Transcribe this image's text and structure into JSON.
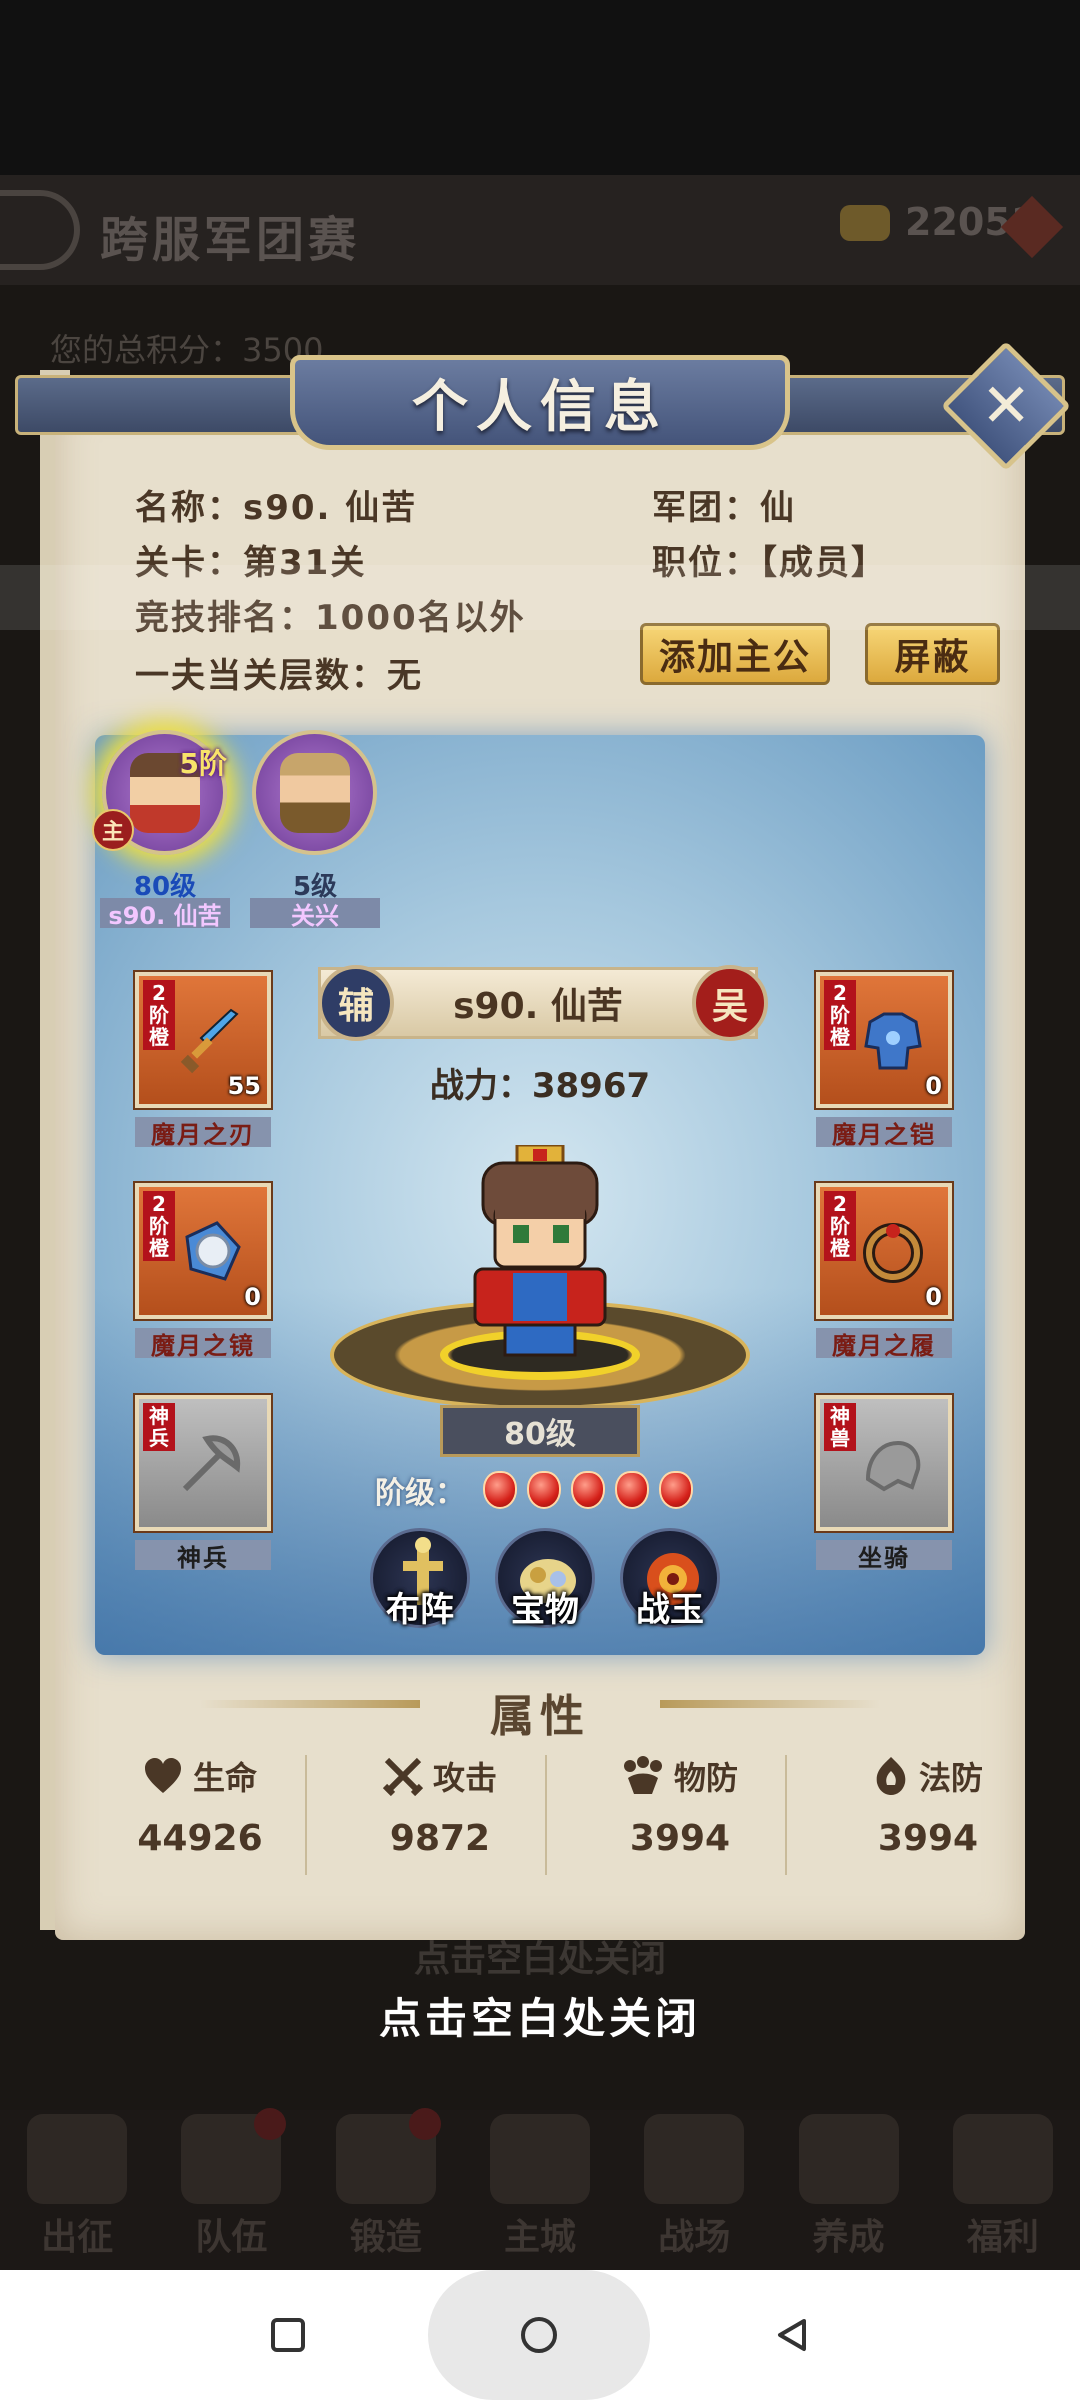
{
  "background": {
    "title": "跨服军团赛",
    "gold": "22051",
    "score_label": "您的总积分：3500",
    "close_hint_echo": "点击空白处关闭",
    "nav": [
      {
        "label": "出征"
      },
      {
        "label": "队伍"
      },
      {
        "label": "锻造"
      },
      {
        "label": "主城"
      },
      {
        "label": "战场"
      },
      {
        "label": "养成"
      },
      {
        "label": "福利"
      }
    ]
  },
  "dialog": {
    "title": "个人信息",
    "name": "名称：s90. 仙苦",
    "guild": "军团：仙",
    "stage": "关卡：第31关",
    "position": "职位：【成员】",
    "arena_rank": "竞技排名：1000名以外",
    "tower_floor": "一夫当关层数：无",
    "add_lord_button": "添加主公",
    "block_button": "屏蔽"
  },
  "heroes": [
    {
      "level": "80级",
      "name": "s90. 仙苦",
      "stage_badge": "5阶",
      "lord_badge": "主"
    },
    {
      "level": "5级",
      "name": "关兴"
    }
  ],
  "detail": {
    "role_left": "辅",
    "hero_name": "s90. 仙苦",
    "faction": "吴",
    "power": "战力：38967",
    "level": "80级",
    "stage_label": "阶级：",
    "stage_gems": 5
  },
  "equipment": [
    {
      "name": "魔月之刃",
      "tag": "2阶橙",
      "count": "55"
    },
    {
      "name": "魔月之铠",
      "tag": "2阶橙",
      "count": "0"
    },
    {
      "name": "魔月之镜",
      "tag": "2阶橙",
      "count": "0"
    },
    {
      "name": "魔月之履",
      "tag": "2阶橙",
      "count": "0"
    },
    {
      "name": "神兵",
      "tag": "神兵"
    },
    {
      "name": "坐骑",
      "tag": "神兽"
    }
  ],
  "functions": [
    {
      "label": "布阵"
    },
    {
      "label": "宝物"
    },
    {
      "label": "战玉"
    }
  ],
  "attributes": {
    "title": "属性",
    "items": [
      {
        "name": "生命",
        "value": "44926",
        "icon": "heart-icon"
      },
      {
        "name": "攻击",
        "value": "9872",
        "icon": "crossed-swords-icon"
      },
      {
        "name": "物防",
        "value": "3994",
        "icon": "paw-shield-icon"
      },
      {
        "name": "法防",
        "value": "3994",
        "icon": "flame-shield-icon"
      }
    ]
  },
  "close_hint": "点击空白处关闭",
  "colors": {
    "panel": "#e7dfcc",
    "title_bar": "#44547a",
    "gold_button": "#dca93d",
    "scene": "#a6c8de"
  }
}
